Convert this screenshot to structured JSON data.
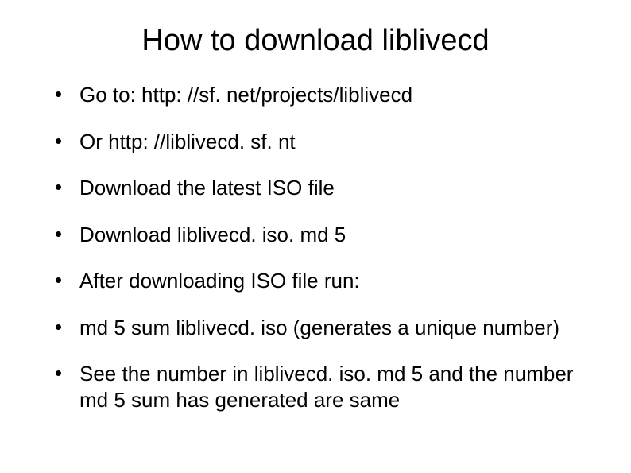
{
  "title": "How to download liblivecd",
  "bullets": [
    "Go to: http: //sf. net/projects/liblivecd",
    "Or http: //liblivecd. sf. nt",
    "Download the latest ISO file",
    "Download liblivecd. iso. md 5",
    "After downloading ISO file run:",
    "md 5 sum liblivecd. iso (generates a unique number)",
    "See the number in liblivecd. iso. md 5 and the number md 5 sum has generated are same"
  ]
}
